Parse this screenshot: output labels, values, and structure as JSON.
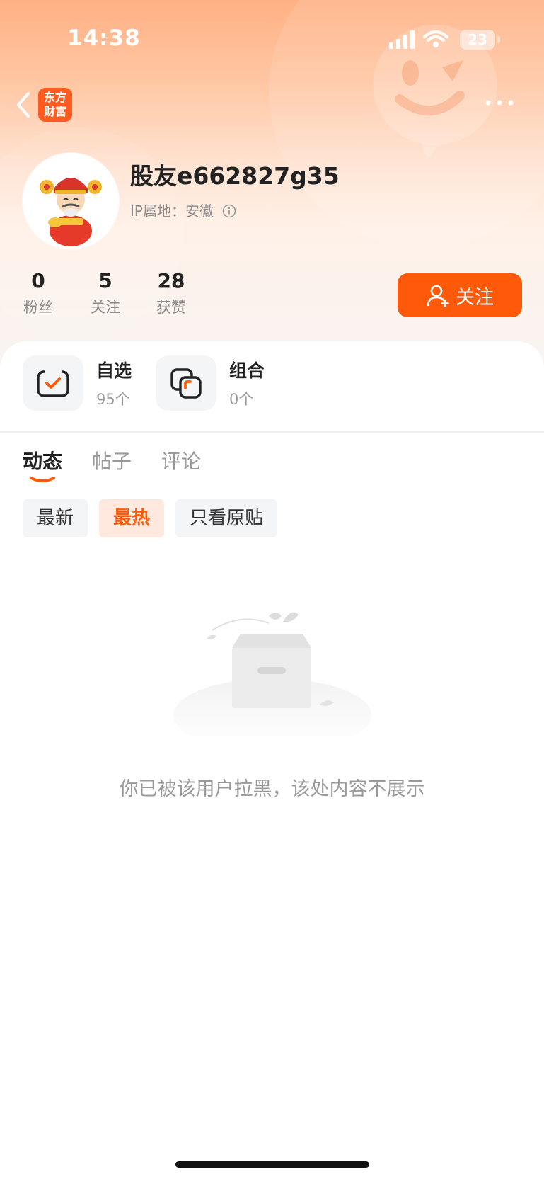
{
  "status_bar": {
    "time": "14:38",
    "battery": "23"
  },
  "nav": {
    "brand_logo_text_line1": "东方",
    "brand_logo_text_line2": "财富"
  },
  "profile": {
    "username": "股友e662827g35",
    "ip_location": "IP属地：安徽"
  },
  "stats": [
    {
      "value": "0",
      "label": "粉丝"
    },
    {
      "value": "5",
      "label": "关注"
    },
    {
      "value": "28",
      "label": "获赞"
    }
  ],
  "follow_button": {
    "label": "关注"
  },
  "cards": [
    {
      "title": "自选",
      "subtitle": "95个"
    },
    {
      "title": "组合",
      "subtitle": "0个"
    }
  ],
  "tabs": [
    {
      "label": "动态",
      "active": true
    },
    {
      "label": "帖子",
      "active": false
    },
    {
      "label": "评论",
      "active": false
    }
  ],
  "filters": [
    {
      "label": "最新",
      "active": false
    },
    {
      "label": "最热",
      "active": true
    },
    {
      "label": "只看原贴",
      "active": false
    }
  ],
  "empty_state": {
    "message": "你已被该用户拉黑，该处内容不展示"
  },
  "colors": {
    "accent": "#ff5a0a",
    "chip_active_bg": "#ffe9df"
  }
}
